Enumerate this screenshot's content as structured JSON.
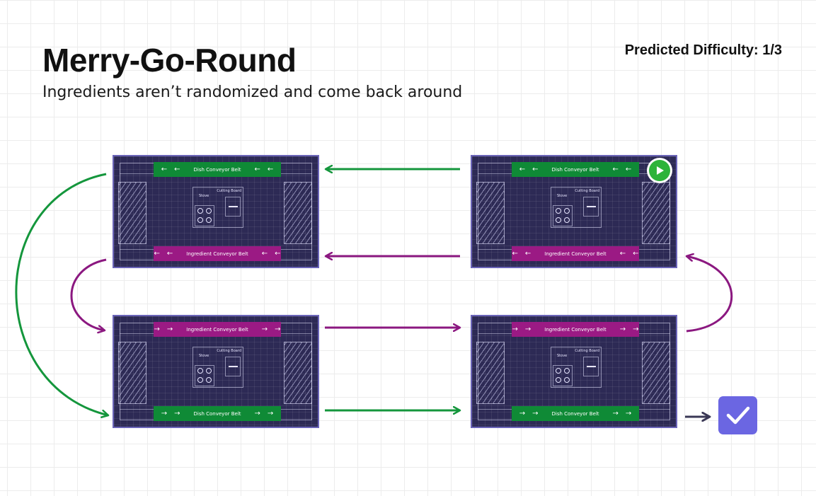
{
  "header": {
    "title": "Merry-Go-Round",
    "subtitle": "Ingredients aren’t randomized and come back around",
    "difficulty": "Predicted Difficulty: 1/3"
  },
  "kitchen_labels": {
    "stove": "Stove",
    "cutting_board": "Cutting Board"
  },
  "kitchens": [
    {
      "id": "top-left",
      "top_belt": "Dish Conveyor Belt",
      "top_type": "dish",
      "bottom_belt": "Ingredient Conveyor Belt",
      "bottom_type": "ingredient",
      "direction": "left",
      "start": false
    },
    {
      "id": "top-right",
      "top_belt": "Dish Conveyor Belt",
      "top_type": "dish",
      "bottom_belt": "Ingredient Conveyor Belt",
      "bottom_type": "ingredient",
      "direction": "left",
      "start": true
    },
    {
      "id": "bottom-left",
      "top_belt": "Ingredient Conveyor Belt",
      "top_type": "ingredient",
      "bottom_belt": "Dish Conveyor Belt",
      "bottom_type": "dish",
      "direction": "right",
      "start": false
    },
    {
      "id": "bottom-right",
      "top_belt": "Ingredient Conveyor Belt",
      "top_type": "ingredient",
      "bottom_belt": "Dish Conveyor Belt",
      "bottom_type": "dish",
      "direction": "right",
      "start": false
    }
  ],
  "colors": {
    "dish_belt": "#0f8a36",
    "ingredient_belt": "#9b1a84",
    "kitchen_bg": "#2d2a55",
    "arrow_green": "#14963c",
    "arrow_purple": "#8b1880",
    "arrow_dark": "#3a3855",
    "check_bg": "#6b66e2",
    "play_green": "#2db33a"
  },
  "icons": {
    "start": "play-icon",
    "finish": "checkmark-icon"
  }
}
